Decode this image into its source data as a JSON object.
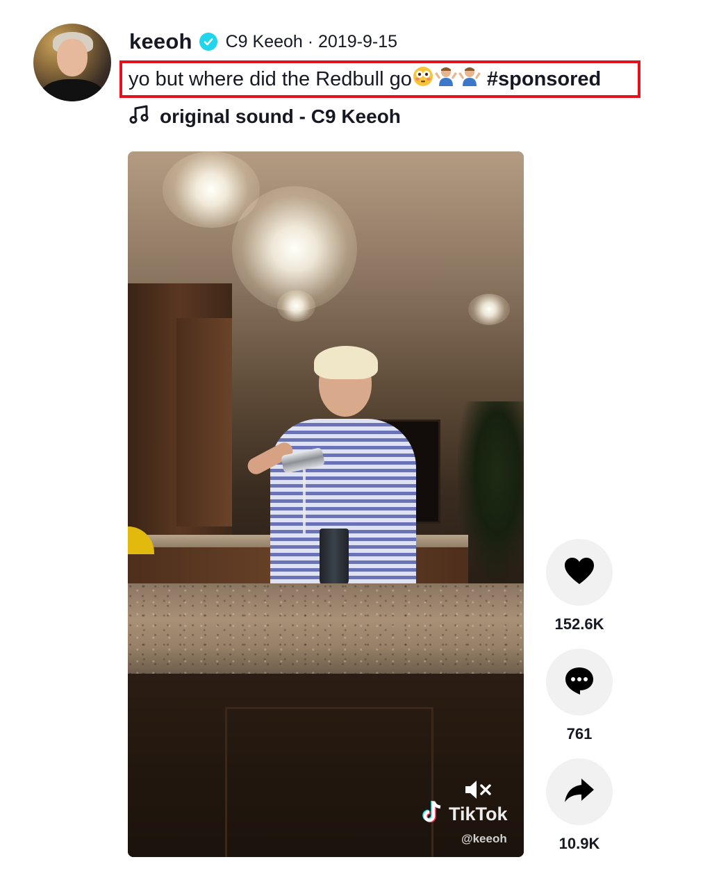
{
  "author": {
    "username": "keeoh",
    "nickname_date": "C9 Keeoh · 2019-9-15",
    "verified": true
  },
  "caption": {
    "text": "yo but where did the Redbull go",
    "emojis": [
      "flushed-face",
      "man-shrugging",
      "man-shrugging"
    ],
    "hashtag": "#sponsored",
    "highlight_color": "#e3111c"
  },
  "sound": {
    "label": "original sound - C9 Keeoh",
    "icon": "music-note-icon"
  },
  "video": {
    "watermark_brand": "TikTok",
    "watermark_handle": "@keeoh",
    "muted": true
  },
  "actions": {
    "likes": "152.6K",
    "comments": "761",
    "shares": "10.9K"
  },
  "colors": {
    "text": "#161823",
    "verified": "#20d5ec",
    "action_bg": "#f1f1f2"
  }
}
